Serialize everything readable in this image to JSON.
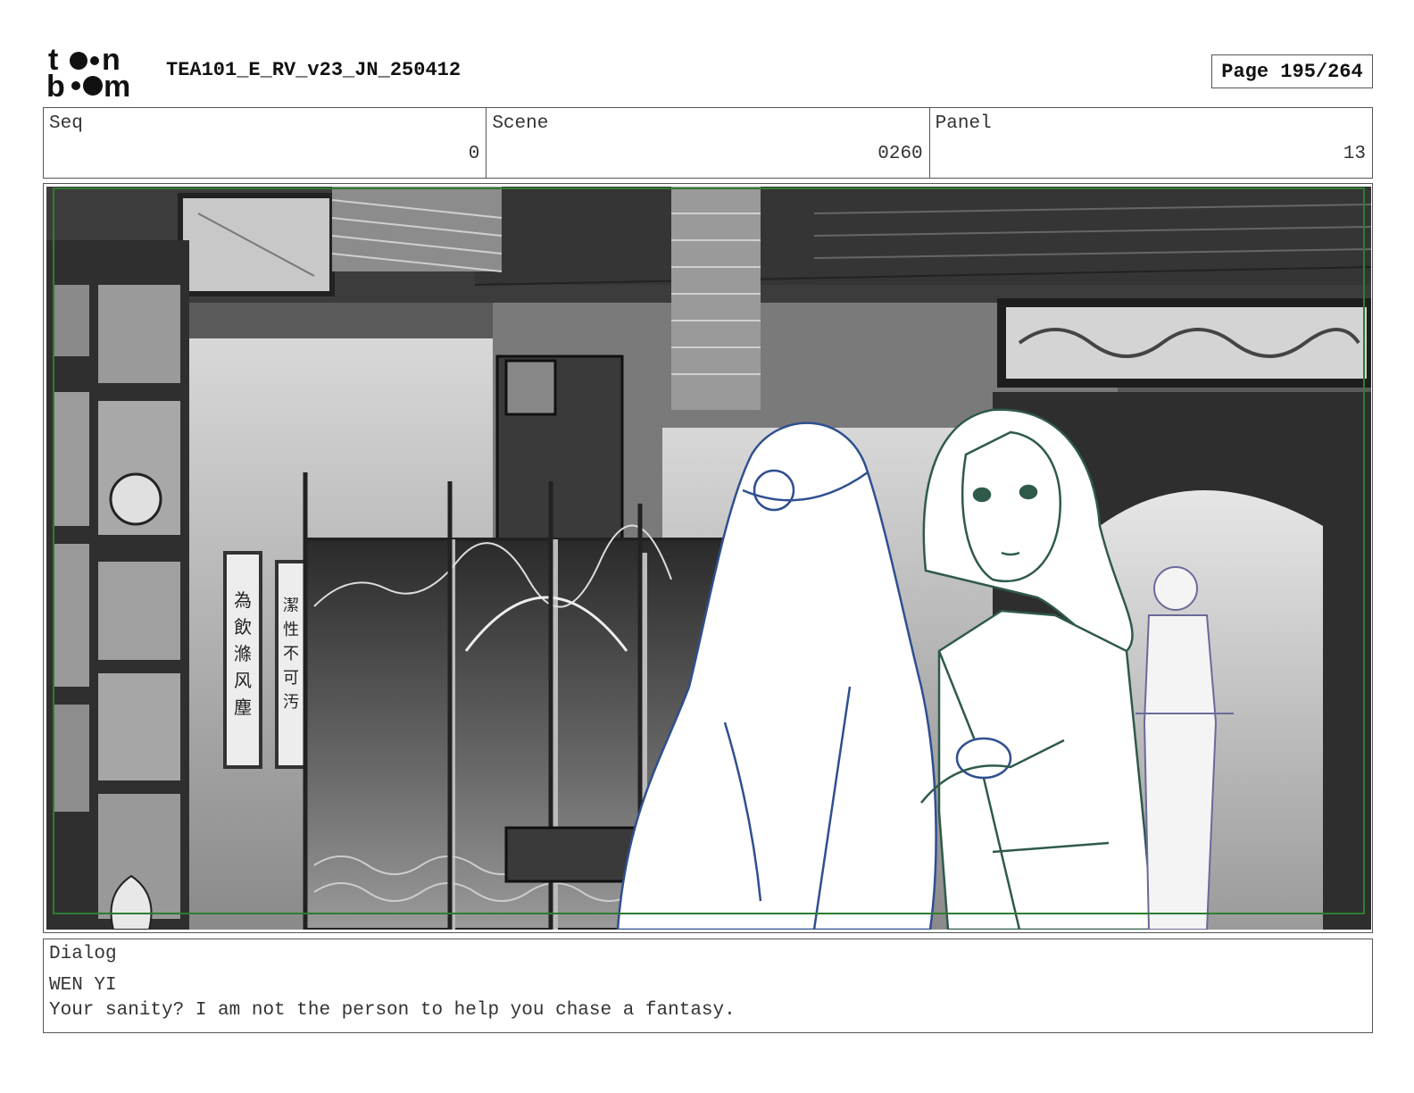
{
  "header": {
    "logo_text": "toon boom",
    "doc_title": "TEA101_E_RV_v23_JN_250412",
    "page_label": "Page 195/264"
  },
  "info": {
    "seq_label": "Seq",
    "seq_value": "0",
    "scene_label": "Scene",
    "scene_value": "0260",
    "panel_label": "Panel",
    "panel_value": "13"
  },
  "panel": {
    "scroll_left": [
      "為",
      "飲",
      "滌",
      "风",
      "塵"
    ],
    "scroll_right": [
      "潔",
      "性",
      "不",
      "可",
      "汚"
    ],
    "safe_frame_color": "#2e7d32",
    "character_line_colors": [
      "#2f4f8f",
      "#2f5a4a",
      "#6a6a9a"
    ]
  },
  "dialog": {
    "label": "Dialog",
    "speaker": "WEN YI",
    "line": "Your sanity? I am not the person to help you chase a fantasy."
  }
}
